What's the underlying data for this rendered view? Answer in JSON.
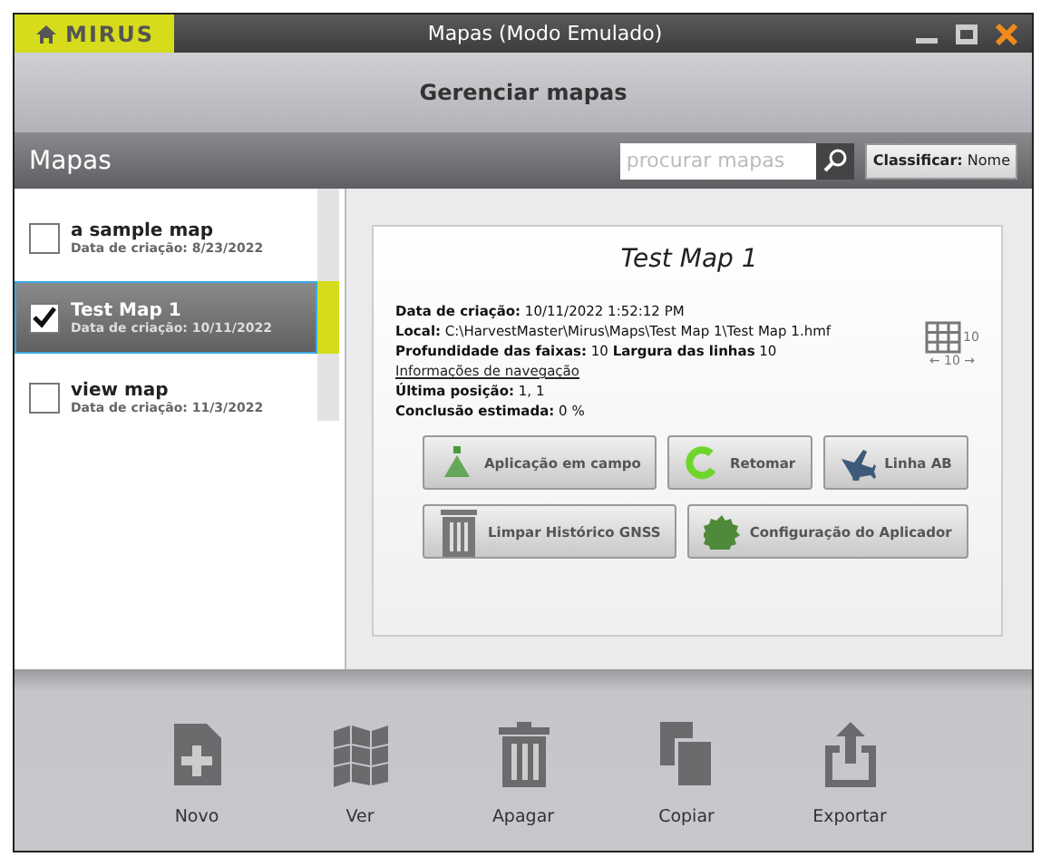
{
  "window": {
    "brand": "MIRUS",
    "title": "Mapas (Modo Emulado)"
  },
  "header": {
    "title": "Gerenciar mapas"
  },
  "toolbar": {
    "title": "Mapas",
    "search": {
      "placeholder": "procurar mapas"
    },
    "sort": "**Classificar:** Nome"
  },
  "maps": [
    {
      "name": "a sample map",
      "created": "Data de criação:  8/23/2022",
      "selected": false,
      "checked": false
    },
    {
      "name": "Test Map 1",
      "created": "Data de criação:  10/11/2022",
      "selected": true,
      "checked": true
    },
    {
      "name": "view map",
      "created": "Data de criação:  11/3/2022",
      "selected": false,
      "checked": false
    }
  ],
  "details": {
    "title": "Test Map 1",
    "lines": [
      {
        "kind": "text",
        "text": "**Data de criação:**  10/11/2022 1:52:12 PM"
      },
      {
        "kind": "text",
        "text": "**Local:**  C:\\HarvestMaster\\Mirus\\Maps\\Test Map 1\\Test Map 1.hmf"
      },
      {
        "kind": "text",
        "text": "**Profundidade das faixas:** 10 **Largura das linhas** 10"
      },
      {
        "kind": "link",
        "text": "Informações de navegação"
      },
      {
        "kind": "text",
        "text": "**Última posição:** 1, 1"
      },
      {
        "kind": "text",
        "text": "**Conclusão estimada:** 0 %"
      }
    ],
    "grid": {
      "rows": "10",
      "columns": "← 10 →"
    },
    "buttons": [
      [
        {
          "label": "Aplicação em campo"
        },
        {
          "label": "Retomar"
        },
        {
          "label": "Linha AB"
        }
      ],
      [
        {
          "label": "Limpar Histórico GNSS"
        },
        {
          "label": "Configuração do Aplicador"
        }
      ]
    ]
  },
  "actions": [
    {
      "label": "Novo"
    },
    {
      "label": "Ver"
    },
    {
      "label": "Apagar"
    },
    {
      "label": "Copiar"
    },
    {
      "label": "Exportar"
    }
  ]
}
